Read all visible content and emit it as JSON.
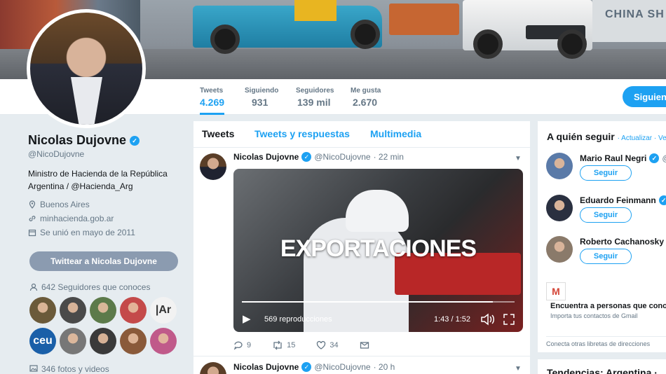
{
  "banner": {
    "wall_text": "CHINA SH"
  },
  "nav": {
    "stats": [
      {
        "label": "Tweets",
        "value": "4.269"
      },
      {
        "label": "Siguiendo",
        "value": "931"
      },
      {
        "label": "Seguidores",
        "value": "139 mil"
      },
      {
        "label": "Me gusta",
        "value": "2.670"
      }
    ],
    "follow_label": "Siguiendo"
  },
  "profile": {
    "name": "Nicolas Dujovne",
    "handle": "@NicoDujovne",
    "bio": "Ministro de Hacienda de la República Argentina / @Hacienda_Arg",
    "location": "Buenos Aires",
    "url": "minhacienda.gob.ar",
    "joined": "Se unió en mayo de 2011",
    "tweet_to": "Twittear a Nicolas Dujovne",
    "known_followers": "642 Seguidores que conoces",
    "photos": "346 fotos y videos"
  },
  "known_avatars": [
    {
      "color": "#6b5a3a",
      "text": ""
    },
    {
      "color": "#4a4a4a",
      "text": ""
    },
    {
      "color": "#5c7a4a",
      "text": ""
    },
    {
      "color": "#c44a4a",
      "text": ""
    },
    {
      "color": "#f2f2f2",
      "text": "|Ar"
    },
    {
      "color": "#1a5fa8",
      "text": "ceu"
    },
    {
      "color": "#777777",
      "text": ""
    },
    {
      "color": "#3a3a3a",
      "text": ""
    },
    {
      "color": "#8a5a3a",
      "text": ""
    },
    {
      "color": "#c05a8a",
      "text": ""
    }
  ],
  "timeline": {
    "tabs": [
      "Tweets",
      "Tweets y respuestas",
      "Multimedia"
    ],
    "tweets": [
      {
        "name": "Nicolas Dujovne",
        "handle": "@NicoDujovne",
        "time": "· 22 min"
      },
      {
        "name": "Nicolas Dujovne",
        "handle": "@NicoDujovne",
        "time": "· 20 h"
      }
    ],
    "video": {
      "title": "EXPORTACIONES",
      "views": "569 reproducciones",
      "time": "1:43 / 1:52",
      "progress": 0.92
    },
    "actions": {
      "replies": "9",
      "retweets": "15",
      "likes": "34"
    }
  },
  "who_to_follow": {
    "title": "A quién seguir",
    "refresh": "· Actualizar · Ve",
    "users": [
      {
        "name": "Mario Raul Negri",
        "handle": "@",
        "button": "Seguir",
        "color": "#5a7aa8"
      },
      {
        "name": "Eduardo Feinmann",
        "handle": "@",
        "button": "Seguir",
        "color": "#2a3040"
      },
      {
        "name": "Roberto Cachanosky",
        "handle": "@",
        "button": "Seguir",
        "color": "#8a7a6a"
      }
    ],
    "find_title": "Encuentra a personas que conoc",
    "find_sub": "Importa tus contactos de Gmail",
    "connect": "Conecta otras libretas de direcciones",
    "gmail_letter": "M"
  },
  "trends": {
    "title": "Tendencias: Argentina ·"
  }
}
